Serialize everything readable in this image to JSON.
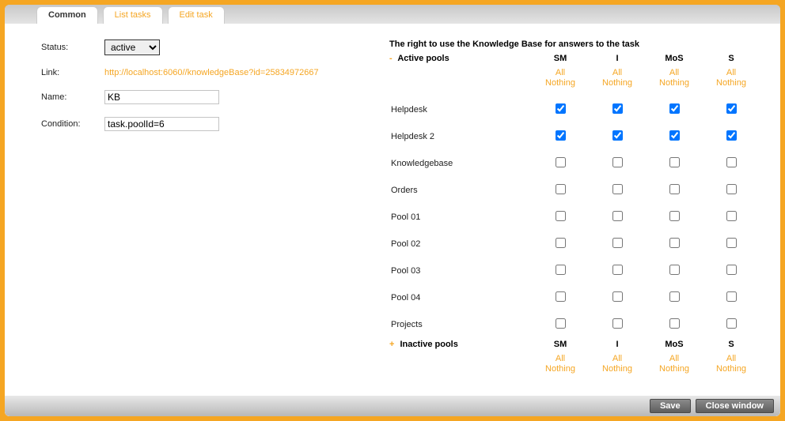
{
  "tabs": [
    {
      "label": "Common",
      "active": true
    },
    {
      "label": "List tasks",
      "active": false
    },
    {
      "label": "Edit task",
      "active": false
    }
  ],
  "fields": {
    "status_label": "Status:",
    "status_value": "active",
    "link_label": "Link:",
    "link_value": "http://localhost:6060//knowledgeBase?id=25834972667",
    "name_label": "Name:",
    "name_value": "KB",
    "condition_label": "Condition:",
    "condition_value": "task.poolId=6"
  },
  "right_title": "The right to use the Knowledge Base for answers to the task",
  "columns": [
    "SM",
    "I",
    "MoS",
    "S"
  ],
  "active_section": {
    "toggle": "-",
    "label": "Active pools",
    "all_label": "All",
    "nothing_label": "Nothing",
    "rows": [
      {
        "name": "Helpdesk",
        "checks": [
          true,
          true,
          true,
          true
        ]
      },
      {
        "name": "Helpdesk 2",
        "checks": [
          true,
          true,
          true,
          true
        ]
      },
      {
        "name": "Knowledgebase",
        "checks": [
          false,
          false,
          false,
          false
        ]
      },
      {
        "name": "Orders",
        "checks": [
          false,
          false,
          false,
          false
        ]
      },
      {
        "name": "Pool 01",
        "checks": [
          false,
          false,
          false,
          false
        ]
      },
      {
        "name": "Pool 02",
        "checks": [
          false,
          false,
          false,
          false
        ]
      },
      {
        "name": "Pool 03",
        "checks": [
          false,
          false,
          false,
          false
        ]
      },
      {
        "name": "Pool 04",
        "checks": [
          false,
          false,
          false,
          false
        ]
      },
      {
        "name": "Projects",
        "checks": [
          false,
          false,
          false,
          false
        ]
      }
    ]
  },
  "inactive_section": {
    "toggle": "+",
    "label": "Inactive pools",
    "all_label": "All",
    "nothing_label": "Nothing"
  },
  "buttons": {
    "save": "Save",
    "close": "Close window"
  }
}
